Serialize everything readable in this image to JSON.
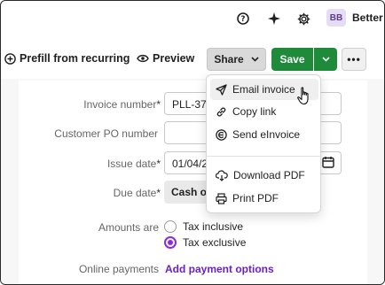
{
  "topbar": {
    "avatar_initials": "BB",
    "org_name": "Better",
    "icons": [
      "help-circle-icon",
      "sparkle-icon",
      "gear-icon"
    ]
  },
  "actions": {
    "prefill_label": "Prefill from recurring",
    "preview_label": "Preview",
    "share_label": "Share",
    "save_label": "Save",
    "more_label": "•••"
  },
  "form": {
    "invoice_number_label": "Invoice number",
    "invoice_number_value": "PLL-374",
    "customer_po_label": "Customer PO number",
    "customer_po_value": "",
    "issue_date_label": "Issue date",
    "issue_date_value": "01/04/2",
    "due_date_label": "Due date",
    "due_date_value": "Cash o",
    "required_mark": "*",
    "amounts_label": "Amounts are",
    "amount_options": [
      {
        "label": "Tax inclusive",
        "selected": false
      },
      {
        "label": "Tax exclusive",
        "selected": true
      }
    ],
    "online_payments_label": "Online payments",
    "add_payment_link": "Add payment options"
  },
  "share_menu": {
    "items": [
      {
        "label": "Email invoice",
        "icon": "send-icon"
      },
      {
        "label": "Copy link",
        "icon": "link-icon"
      },
      {
        "label": "Send eInvoice",
        "icon": "einvoice-icon"
      },
      {
        "label": "Download PDF",
        "icon": "download-cloud-icon"
      },
      {
        "label": "Print PDF",
        "icon": "printer-icon"
      }
    ]
  },
  "colors": {
    "save_green": "#1f8a3a",
    "accent_purple": "#8a2be2",
    "link_purple": "#6a1fd1"
  }
}
